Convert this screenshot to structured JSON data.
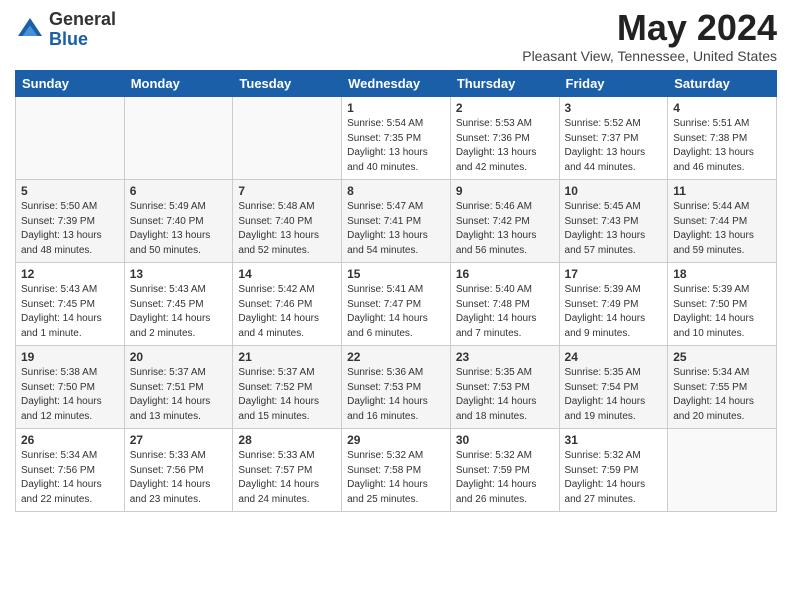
{
  "logo": {
    "general": "General",
    "blue": "Blue"
  },
  "title": "May 2024",
  "location": "Pleasant View, Tennessee, United States",
  "weekdays": [
    "Sunday",
    "Monday",
    "Tuesday",
    "Wednesday",
    "Thursday",
    "Friday",
    "Saturday"
  ],
  "weeks": [
    [
      {
        "day": "",
        "content": ""
      },
      {
        "day": "",
        "content": ""
      },
      {
        "day": "",
        "content": ""
      },
      {
        "day": "1",
        "content": "Sunrise: 5:54 AM\nSunset: 7:35 PM\nDaylight: 13 hours\nand 40 minutes."
      },
      {
        "day": "2",
        "content": "Sunrise: 5:53 AM\nSunset: 7:36 PM\nDaylight: 13 hours\nand 42 minutes."
      },
      {
        "day": "3",
        "content": "Sunrise: 5:52 AM\nSunset: 7:37 PM\nDaylight: 13 hours\nand 44 minutes."
      },
      {
        "day": "4",
        "content": "Sunrise: 5:51 AM\nSunset: 7:38 PM\nDaylight: 13 hours\nand 46 minutes."
      }
    ],
    [
      {
        "day": "5",
        "content": "Sunrise: 5:50 AM\nSunset: 7:39 PM\nDaylight: 13 hours\nand 48 minutes."
      },
      {
        "day": "6",
        "content": "Sunrise: 5:49 AM\nSunset: 7:40 PM\nDaylight: 13 hours\nand 50 minutes."
      },
      {
        "day": "7",
        "content": "Sunrise: 5:48 AM\nSunset: 7:40 PM\nDaylight: 13 hours\nand 52 minutes."
      },
      {
        "day": "8",
        "content": "Sunrise: 5:47 AM\nSunset: 7:41 PM\nDaylight: 13 hours\nand 54 minutes."
      },
      {
        "day": "9",
        "content": "Sunrise: 5:46 AM\nSunset: 7:42 PM\nDaylight: 13 hours\nand 56 minutes."
      },
      {
        "day": "10",
        "content": "Sunrise: 5:45 AM\nSunset: 7:43 PM\nDaylight: 13 hours\nand 57 minutes."
      },
      {
        "day": "11",
        "content": "Sunrise: 5:44 AM\nSunset: 7:44 PM\nDaylight: 13 hours\nand 59 minutes."
      }
    ],
    [
      {
        "day": "12",
        "content": "Sunrise: 5:43 AM\nSunset: 7:45 PM\nDaylight: 14 hours\nand 1 minute."
      },
      {
        "day": "13",
        "content": "Sunrise: 5:43 AM\nSunset: 7:45 PM\nDaylight: 14 hours\nand 2 minutes."
      },
      {
        "day": "14",
        "content": "Sunrise: 5:42 AM\nSunset: 7:46 PM\nDaylight: 14 hours\nand 4 minutes."
      },
      {
        "day": "15",
        "content": "Sunrise: 5:41 AM\nSunset: 7:47 PM\nDaylight: 14 hours\nand 6 minutes."
      },
      {
        "day": "16",
        "content": "Sunrise: 5:40 AM\nSunset: 7:48 PM\nDaylight: 14 hours\nand 7 minutes."
      },
      {
        "day": "17",
        "content": "Sunrise: 5:39 AM\nSunset: 7:49 PM\nDaylight: 14 hours\nand 9 minutes."
      },
      {
        "day": "18",
        "content": "Sunrise: 5:39 AM\nSunset: 7:50 PM\nDaylight: 14 hours\nand 10 minutes."
      }
    ],
    [
      {
        "day": "19",
        "content": "Sunrise: 5:38 AM\nSunset: 7:50 PM\nDaylight: 14 hours\nand 12 minutes."
      },
      {
        "day": "20",
        "content": "Sunrise: 5:37 AM\nSunset: 7:51 PM\nDaylight: 14 hours\nand 13 minutes."
      },
      {
        "day": "21",
        "content": "Sunrise: 5:37 AM\nSunset: 7:52 PM\nDaylight: 14 hours\nand 15 minutes."
      },
      {
        "day": "22",
        "content": "Sunrise: 5:36 AM\nSunset: 7:53 PM\nDaylight: 14 hours\nand 16 minutes."
      },
      {
        "day": "23",
        "content": "Sunrise: 5:35 AM\nSunset: 7:53 PM\nDaylight: 14 hours\nand 18 minutes."
      },
      {
        "day": "24",
        "content": "Sunrise: 5:35 AM\nSunset: 7:54 PM\nDaylight: 14 hours\nand 19 minutes."
      },
      {
        "day": "25",
        "content": "Sunrise: 5:34 AM\nSunset: 7:55 PM\nDaylight: 14 hours\nand 20 minutes."
      }
    ],
    [
      {
        "day": "26",
        "content": "Sunrise: 5:34 AM\nSunset: 7:56 PM\nDaylight: 14 hours\nand 22 minutes."
      },
      {
        "day": "27",
        "content": "Sunrise: 5:33 AM\nSunset: 7:56 PM\nDaylight: 14 hours\nand 23 minutes."
      },
      {
        "day": "28",
        "content": "Sunrise: 5:33 AM\nSunset: 7:57 PM\nDaylight: 14 hours\nand 24 minutes."
      },
      {
        "day": "29",
        "content": "Sunrise: 5:32 AM\nSunset: 7:58 PM\nDaylight: 14 hours\nand 25 minutes."
      },
      {
        "day": "30",
        "content": "Sunrise: 5:32 AM\nSunset: 7:59 PM\nDaylight: 14 hours\nand 26 minutes."
      },
      {
        "day": "31",
        "content": "Sunrise: 5:32 AM\nSunset: 7:59 PM\nDaylight: 14 hours\nand 27 minutes."
      },
      {
        "day": "",
        "content": ""
      }
    ]
  ]
}
